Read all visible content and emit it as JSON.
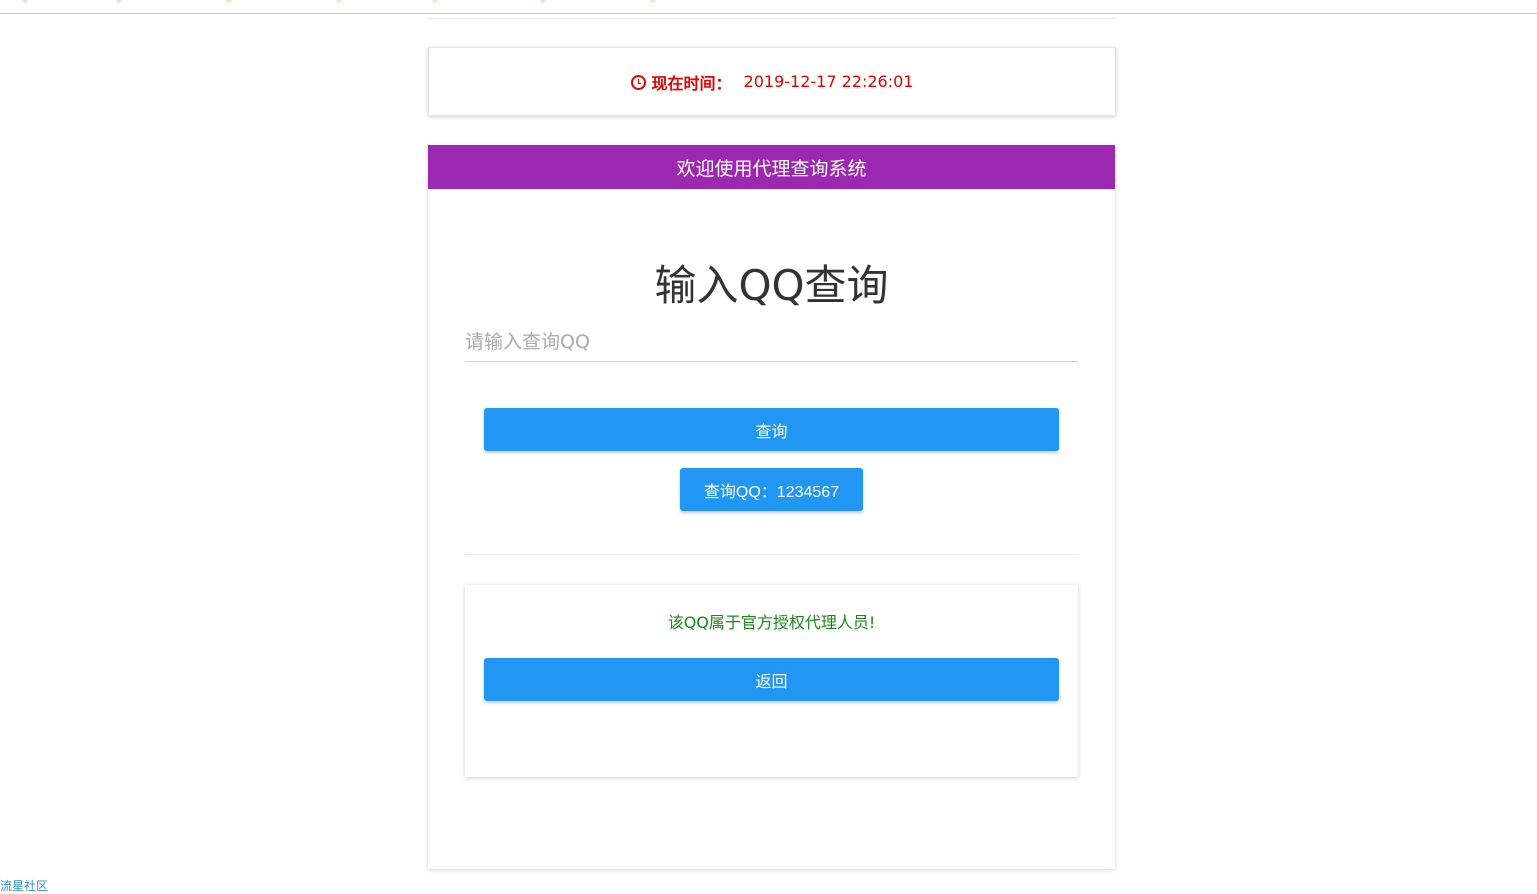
{
  "time_card": {
    "label": "现在时间：",
    "value": "2019-12-17 22:26:01",
    "icon": "clock-icon",
    "color": "#e60000"
  },
  "main": {
    "header_title": "欢迎使用代理查询系统",
    "header_color": "#9c27b0",
    "heading": "输入QQ查询",
    "input_placeholder": "请输入查询QQ",
    "search_button": "查询",
    "queried_qq_button": "查询QQ：1234567",
    "button_color": "#2196f3"
  },
  "result": {
    "message": "该QQ属于官方授权代理人员!",
    "message_color": "#198a19",
    "back_button": "返回"
  },
  "footer": {
    "link_text": "流星社区"
  }
}
